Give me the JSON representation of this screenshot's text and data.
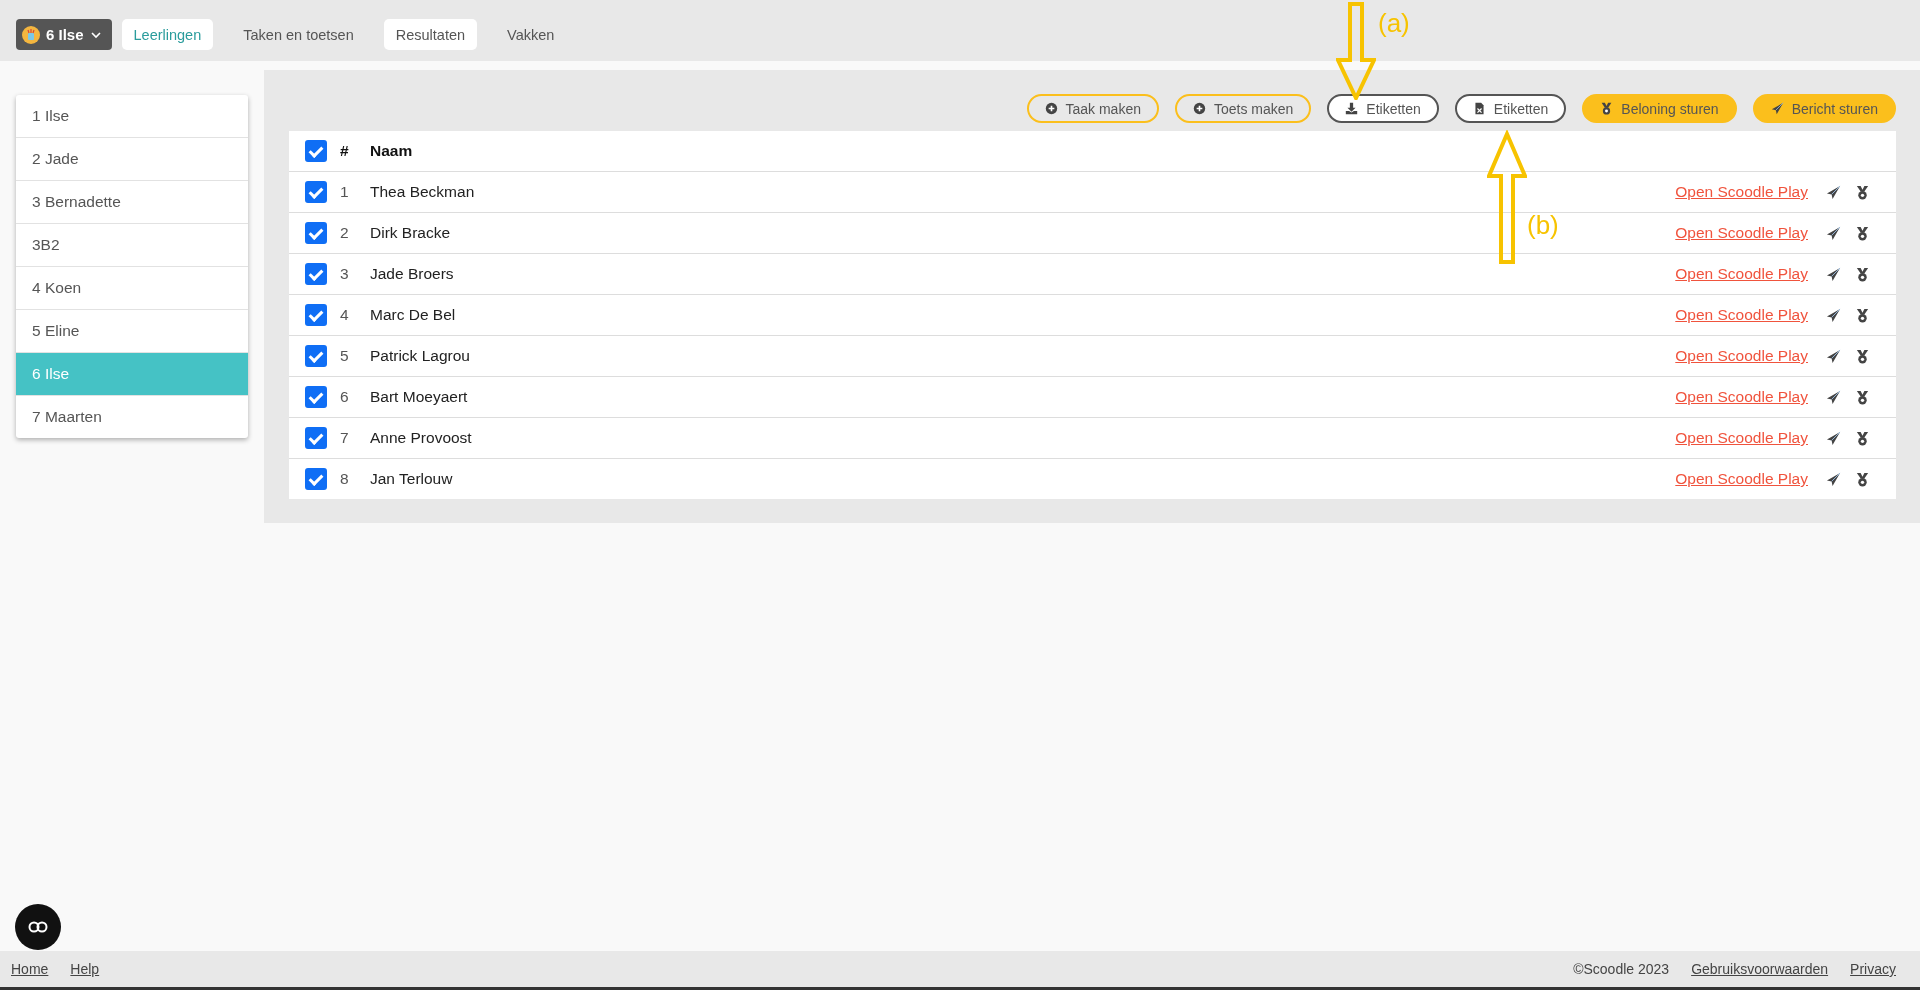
{
  "class_selector": {
    "label": "6 Ilse"
  },
  "nav_tabs": [
    {
      "label": "Leerlingen",
      "selected": true,
      "highlighted": true
    },
    {
      "label": "Taken en toetsen",
      "selected": false,
      "highlighted": false
    },
    {
      "label": "Resultaten",
      "selected": false,
      "highlighted": true
    },
    {
      "label": "Vakken",
      "selected": false,
      "highlighted": false
    }
  ],
  "sidebar": {
    "items": [
      {
        "label": "1 Ilse",
        "selected": false
      },
      {
        "label": "2 Jade",
        "selected": false
      },
      {
        "label": "3 Bernadette",
        "selected": false
      },
      {
        "label": "3B2",
        "selected": false
      },
      {
        "label": "4 Koen",
        "selected": false
      },
      {
        "label": "5 Eline",
        "selected": false
      },
      {
        "label": "6 Ilse",
        "selected": true
      },
      {
        "label": "7 Maarten",
        "selected": false
      }
    ]
  },
  "actions": [
    {
      "label": "Taak maken",
      "kind": "create"
    },
    {
      "label": "Toets maken",
      "kind": "create"
    },
    {
      "label": "Etiketten",
      "kind": "download"
    },
    {
      "label": "Etiketten",
      "kind": "export"
    },
    {
      "label": "Beloning sturen",
      "kind": "reward"
    },
    {
      "label": "Bericht sturen",
      "kind": "message"
    }
  ],
  "table": {
    "header_checked": true,
    "columns": [
      "#",
      "Naam"
    ],
    "rows": [
      {
        "number": "1",
        "name": "Thea Beckman",
        "checked": true,
        "link": "Open Scoodle Play"
      },
      {
        "number": "2",
        "name": "Dirk Bracke",
        "checked": true,
        "link": "Open Scoodle Play"
      },
      {
        "number": "3",
        "name": "Jade Broers",
        "checked": true,
        "link": "Open Scoodle Play"
      },
      {
        "number": "4",
        "name": "Marc De Bel",
        "checked": true,
        "link": "Open Scoodle Play"
      },
      {
        "number": "5",
        "name": "Patrick Lagrou",
        "checked": true,
        "link": "Open Scoodle Play"
      },
      {
        "number": "6",
        "name": "Bart Moeyaert",
        "checked": true,
        "link": "Open Scoodle Play"
      },
      {
        "number": "7",
        "name": "Anne Provoost",
        "checked": true,
        "link": "Open Scoodle Play"
      },
      {
        "number": "8",
        "name": "Jan Terlouw",
        "checked": true,
        "link": "Open Scoodle Play"
      }
    ]
  },
  "annotations": [
    {
      "label": "(a)",
      "kind": "down"
    },
    {
      "label": "(b)",
      "kind": "up"
    }
  ],
  "footer": {
    "left_links": [
      "Home",
      "Help"
    ],
    "copyright": "©Scoodle 2023",
    "right_links": [
      "Gebruiksvoorwaarden",
      "Privacy"
    ]
  }
}
